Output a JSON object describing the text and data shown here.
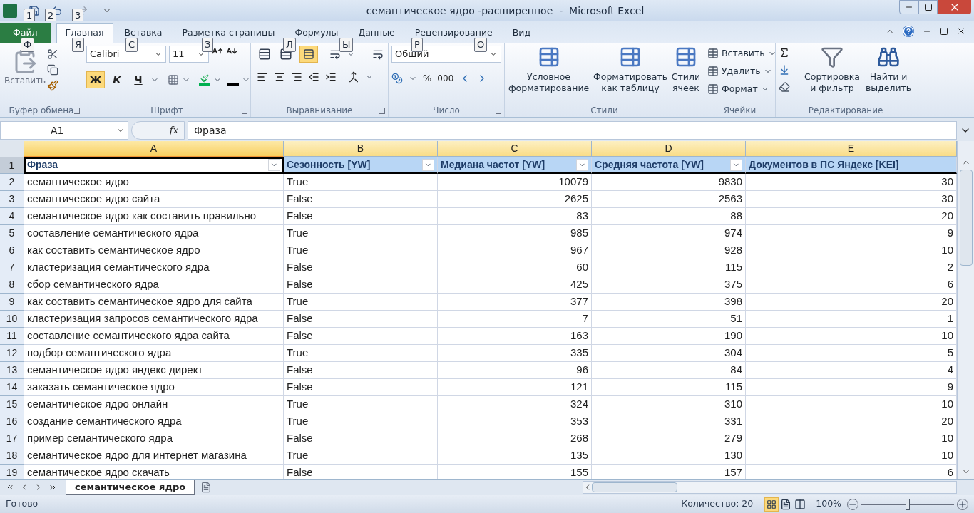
{
  "window": {
    "title": "семантическое ядро -расширенное  -  Microsoft Excel",
    "quick_access_keytips": [
      "1",
      "2",
      "3"
    ]
  },
  "ribbon_tabs": [
    {
      "label": "Файл",
      "kind": "file",
      "selected": false,
      "keytip": "Ф"
    },
    {
      "label": "Главная",
      "kind": "tab",
      "selected": true,
      "keytip": "Я"
    },
    {
      "label": "Вставка",
      "kind": "tab",
      "selected": false,
      "keytip": "С"
    },
    {
      "label": "Разметка страницы",
      "kind": "tab",
      "selected": false,
      "keytip": "З"
    },
    {
      "label": "Формулы",
      "kind": "tab",
      "selected": false,
      "keytip": "Л"
    },
    {
      "label": "Данные",
      "kind": "tab",
      "selected": false,
      "keytip": "Ы"
    },
    {
      "label": "Рецензирование",
      "kind": "tab",
      "selected": false,
      "keytip": "Р"
    },
    {
      "label": "Вид",
      "kind": "tab",
      "selected": false,
      "keytip": "О"
    }
  ],
  "ribbon": {
    "clipboard": {
      "paste": "Вставить",
      "caption": "Буфер обмена"
    },
    "font": {
      "name": "Calibri",
      "size": "11",
      "bold": {
        "label": "Ж",
        "selected": true
      },
      "italic": {
        "label": "К",
        "selected": false
      },
      "underline": {
        "label": "Ч",
        "selected": false
      },
      "caption": "Шрифт"
    },
    "alignment": {
      "bottom_align_selected": true,
      "caption": "Выравнивание"
    },
    "number": {
      "format": "Общий",
      "percent": "%",
      "thousands": "000",
      "caption": "Число"
    },
    "styles": {
      "buttons": [
        "Условное\nформатирование",
        "Форматировать\nкак таблицу",
        "Стили\nячеек"
      ],
      "caption": "Стили"
    },
    "cells": {
      "buttons": [
        "Вставить",
        "Удалить",
        "Формат"
      ],
      "caption": "Ячейки"
    },
    "editing": {
      "buttons": [
        "Сортировка\nи фильтр",
        "Найти и\nвыделить"
      ],
      "caption": "Редактирование"
    }
  },
  "formula_bar": {
    "name_box": "A1",
    "fx": "fx",
    "content": "Фраза"
  },
  "sheet": {
    "columns": [
      {
        "letter": "A",
        "header": "Фраза",
        "kind": "text",
        "filter": true,
        "selected": true
      },
      {
        "letter": "B",
        "header": "Сезонность [YW]",
        "kind": "text",
        "filter": true,
        "selected": false
      },
      {
        "letter": "C",
        "header": "Медиана частот [YW]",
        "kind": "number",
        "filter": true,
        "selected": false
      },
      {
        "letter": "D",
        "header": "Средняя частота [YW]",
        "kind": "number",
        "filter": true,
        "selected": false
      },
      {
        "letter": "E",
        "header": "Документов в ПС Яндекс [KEI]",
        "kind": "number",
        "filter": false,
        "selected": false
      }
    ],
    "header_row_number": "1",
    "rows": [
      {
        "n": "2",
        "cells": [
          "семантическое ядро",
          "True",
          "10079",
          "9830",
          "30"
        ]
      },
      {
        "n": "3",
        "cells": [
          "семантическое ядро сайта",
          "False",
          "2625",
          "2563",
          "30"
        ]
      },
      {
        "n": "4",
        "cells": [
          "семантическое ядро как составить правильно",
          "False",
          "83",
          "88",
          "20"
        ]
      },
      {
        "n": "5",
        "cells": [
          "составление семантического ядра",
          "True",
          "985",
          "974",
          "9"
        ]
      },
      {
        "n": "6",
        "cells": [
          "как составить семантическое ядро",
          "True",
          "967",
          "928",
          "10"
        ]
      },
      {
        "n": "7",
        "cells": [
          "кластеризация семантического ядра",
          "False",
          "60",
          "115",
          "2"
        ]
      },
      {
        "n": "8",
        "cells": [
          "сбор семантического ядра",
          "False",
          "425",
          "375",
          "6"
        ]
      },
      {
        "n": "9",
        "cells": [
          "как составить семантическое ядро для сайта",
          "True",
          "377",
          "398",
          "20"
        ]
      },
      {
        "n": "10",
        "cells": [
          "кластеризация запросов семантического ядра",
          "False",
          "7",
          "51",
          "1"
        ]
      },
      {
        "n": "11",
        "cells": [
          "составление семантического ядра сайта",
          "False",
          "163",
          "190",
          "10"
        ]
      },
      {
        "n": "12",
        "cells": [
          "подбор семантического ядра",
          "True",
          "335",
          "304",
          "5"
        ]
      },
      {
        "n": "13",
        "cells": [
          "семантическое ядро яндекс директ",
          "False",
          "96",
          "84",
          "4"
        ]
      },
      {
        "n": "14",
        "cells": [
          "заказать семантическое ядро",
          "False",
          "121",
          "115",
          "9"
        ]
      },
      {
        "n": "15",
        "cells": [
          "семантическое ядро онлайн",
          "True",
          "324",
          "310",
          "10"
        ]
      },
      {
        "n": "16",
        "cells": [
          "создание семантического ядра",
          "True",
          "353",
          "331",
          "20"
        ]
      },
      {
        "n": "17",
        "cells": [
          "пример семантического ядра",
          "False",
          "268",
          "279",
          "10"
        ]
      },
      {
        "n": "18",
        "cells": [
          "семантическое ядро для интернет магазина",
          "True",
          "135",
          "130",
          "10"
        ]
      },
      {
        "n": "19",
        "cells": [
          "семантическое ядро скачать",
          "False",
          "155",
          "157",
          "6"
        ]
      }
    ]
  },
  "sheet_tabs": [
    {
      "label": "семантическое ядро",
      "selected": true
    }
  ],
  "status_bar": {
    "status": "Готово",
    "count": "Количество: 20",
    "zoom": "100%",
    "zoom_slider": {
      "level": 0.5
    },
    "views": [
      {
        "kind": "normal",
        "selected": true
      },
      {
        "kind": "layout",
        "selected": false
      },
      {
        "kind": "pagebreak",
        "selected": false
      }
    ]
  }
}
